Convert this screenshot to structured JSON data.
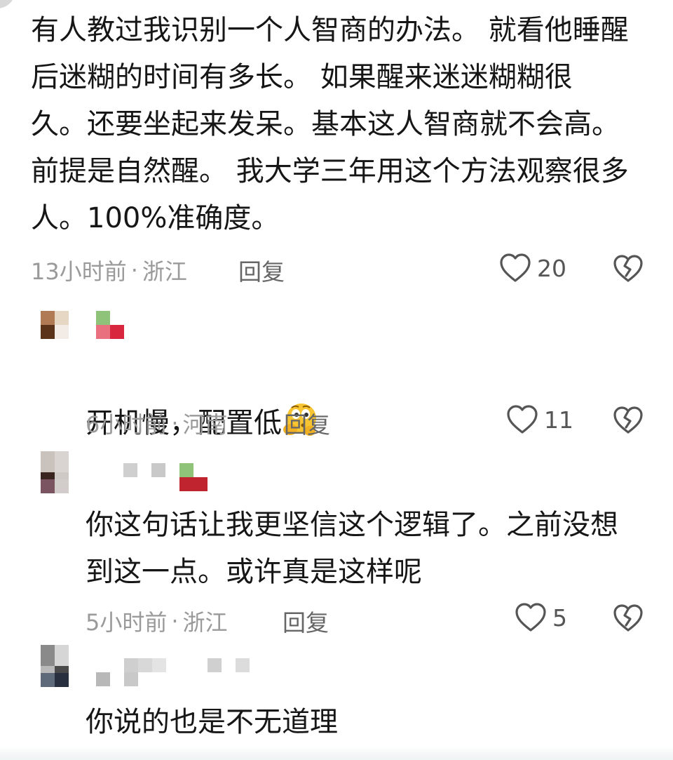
{
  "comments": [
    {
      "text": "有人教过我识别一个人智商的办法。 就看他睡醒\n后迷糊的时间有多长。  如果醒来迷迷糊糊很\n久。还要坐起来发呆。基本这人智商就不会高。\n前提是自然醒。 我大学三年用这个方法观察很多\n人。100%准确度。",
      "time": "13小时前",
      "location": "浙江",
      "reply_label": "回复",
      "likes": "20"
    },
    {
      "text": "开机慢，配置低",
      "emoji": "thinking-face-emoji",
      "time": "6小时前",
      "location": "河南",
      "reply_label": "回复",
      "likes": "11"
    },
    {
      "text": "你这句话让我更坚信这个逻辑了。之前没想\n到这一点。或许真是这样呢",
      "time": "5小时前",
      "location": "浙江",
      "reply_label": "回复",
      "likes": "5"
    },
    {
      "text": "你说的也是不无道理"
    }
  ],
  "separator": "·",
  "icons": {
    "like": "heart-outline-icon",
    "dislike": "broken-heart-icon"
  },
  "colors": {
    "text": "#161616",
    "meta": "#9a9a9a",
    "icon": "#555555"
  }
}
